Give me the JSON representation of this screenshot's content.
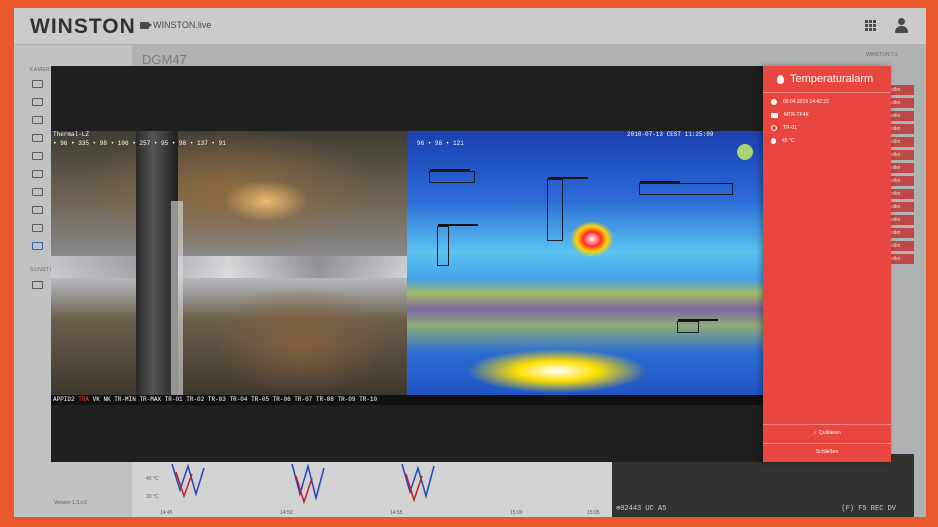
{
  "app": {
    "logo": "WINSTON",
    "live_label": "WINSTON.live",
    "version": "Version 1.3.x.5",
    "page_title": "DGM47",
    "header_right_label": "WINSTON 7.x"
  },
  "sidebar": {
    "section1": "Kameras",
    "section2": "Sonstiges"
  },
  "background_list": [
    "Protkn",
    "Protkn",
    "Protkn",
    "Protkn",
    "Protkn",
    "Protkn",
    "Protkn",
    "Protkn",
    "Protkn",
    "Protkn",
    "Protkn",
    "Protkn",
    "Protkn",
    "Protkn"
  ],
  "chart": {
    "y_labels": [
      "40 °C",
      "20 °C"
    ],
    "x_labels": [
      "14:45",
      "14:50",
      "14:55",
      "15:00",
      "15:05"
    ]
  },
  "background_cam": {
    "left_text": "⊕02443 UC A5",
    "right_text": "(F) F5 REC DV"
  },
  "viewer": {
    "visible_header": "Thermal-LZ",
    "visible_values": "• 96  • 335  • 98  • 106  • 257  • 95  • 98  • 137  • 91",
    "ir_values": "96  • 98  • 121",
    "ir_timestamp": "2018-07-13 CEST 11:25:09",
    "bottom_prefix": "APPID2",
    "bottom_red": "TRA",
    "bottom_rest": "VK NK TR-MIN TR-MAX TR-01 TR-02 TR-03 TR-04 TR-05 TR-06 TR-07 TR-08 TR-09 TR-10"
  },
  "alarm": {
    "title": "Temperaturalarm",
    "datetime": "09.04.2019 14:42:22",
    "camera": "MTR-TF4X",
    "zone": "TR-01",
    "temperature": "45 °C",
    "acknowledge_label": "✓ Quittieren",
    "close_label": "Schließen"
  }
}
